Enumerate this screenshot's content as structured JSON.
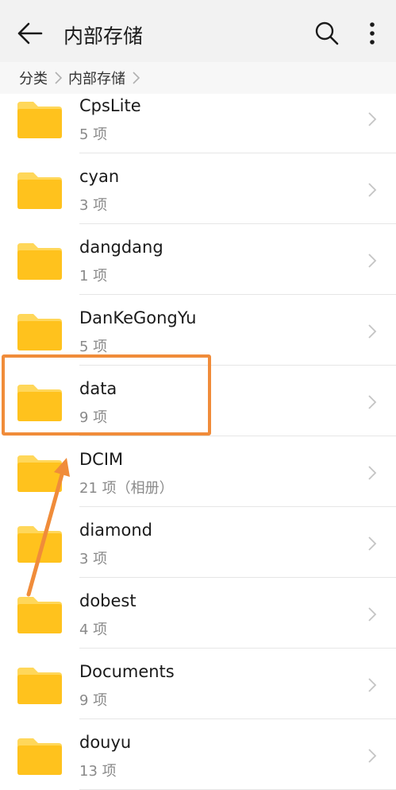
{
  "header": {
    "title": "内部存储",
    "back_icon": "arrow-left-icon",
    "search_icon": "search-icon",
    "more_icon": "more-vertical-icon"
  },
  "breadcrumb": [
    "分类",
    "内部存储"
  ],
  "folders": [
    {
      "name": "CpsLite",
      "count": "5 项"
    },
    {
      "name": "cyan",
      "count": "3 项"
    },
    {
      "name": "dangdang",
      "count": "1 项"
    },
    {
      "name": "DanKeGongYu",
      "count": "5 项"
    },
    {
      "name": "data",
      "count": "9 项"
    },
    {
      "name": "DCIM",
      "count": "21 项（相册）"
    },
    {
      "name": "diamond",
      "count": "3 项"
    },
    {
      "name": "dobest",
      "count": "4 项"
    },
    {
      "name": "Documents",
      "count": "9 项"
    },
    {
      "name": "douyu",
      "count": "13 项"
    }
  ],
  "colors": {
    "folder": "#ffc21d",
    "folder_tab": "#ffd75a",
    "highlight": "#f08c3a",
    "annotation_arrow": "#f08c3a"
  }
}
